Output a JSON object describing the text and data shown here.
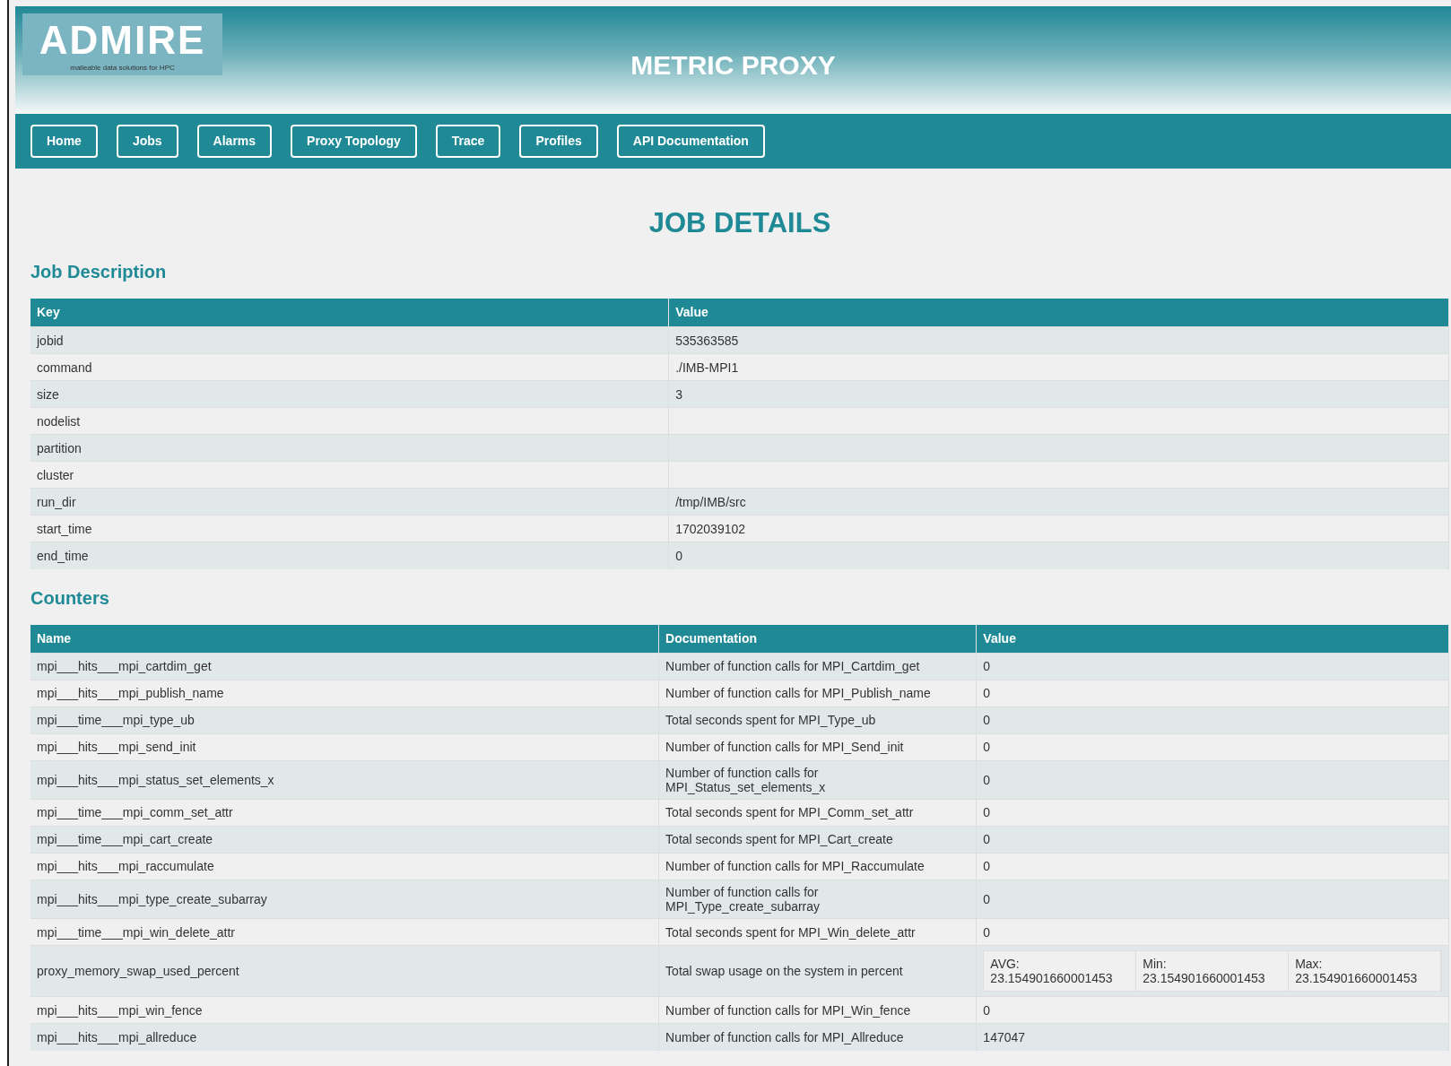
{
  "logo": {
    "wordmark": "ADMIRE",
    "tagline": "malleable data solutions for HPC"
  },
  "header": {
    "title": "METRIC PROXY"
  },
  "nav": [
    {
      "label": "Home"
    },
    {
      "label": "Jobs"
    },
    {
      "label": "Alarms"
    },
    {
      "label": "Proxy Topology"
    },
    {
      "label": "Trace"
    },
    {
      "label": "Profiles"
    },
    {
      "label": "API Documentation"
    }
  ],
  "page_title": "JOB DETAILS",
  "job_description": {
    "heading": "Job Description",
    "columns": [
      "Key",
      "Value"
    ],
    "rows": [
      {
        "key": "jobid",
        "value": "535363585"
      },
      {
        "key": "command",
        "value": "./IMB-MPI1"
      },
      {
        "key": "size",
        "value": "3"
      },
      {
        "key": "nodelist"
      },
      {
        "key": "partition"
      },
      {
        "key": "cluster"
      },
      {
        "key": "run_dir",
        "value": "/tmp/IMB/src"
      },
      {
        "key": "start_time",
        "value": "1702039102"
      },
      {
        "key": "end_time",
        "value": "0"
      }
    ]
  },
  "counters": {
    "heading": "Counters",
    "columns": [
      "Name",
      "Documentation",
      "Value"
    ],
    "rows": [
      {
        "kind": "single",
        "name": "mpi___hits___mpi_cartdim_get",
        "documentation": "Number of function calls for MPI_Cartdim_get",
        "value": "0"
      },
      {
        "kind": "single",
        "name": "mpi___hits___mpi_publish_name",
        "documentation": "Number of function calls for MPI_Publish_name",
        "value": "0"
      },
      {
        "kind": "single",
        "name": "mpi___time___mpi_type_ub",
        "documentation": "Total seconds spent for MPI_Type_ub",
        "value": "0"
      },
      {
        "kind": "single",
        "name": "mpi___hits___mpi_send_init",
        "documentation": "Number of function calls for MPI_Send_init",
        "value": "0"
      },
      {
        "kind": "single",
        "name": "mpi___hits___mpi_status_set_elements_x",
        "documentation": "Number of function calls for MPI_Status_set_elements_x",
        "value": "0"
      },
      {
        "kind": "single",
        "name": "mpi___time___mpi_comm_set_attr",
        "documentation": "Total seconds spent for MPI_Comm_set_attr",
        "value": "0"
      },
      {
        "kind": "single",
        "name": "mpi___time___mpi_cart_create",
        "documentation": "Total seconds spent for MPI_Cart_create",
        "value": "0"
      },
      {
        "kind": "single",
        "name": "mpi___hits___mpi_raccumulate",
        "documentation": "Number of function calls for MPI_Raccumulate",
        "value": "0"
      },
      {
        "kind": "single",
        "name": "mpi___hits___mpi_type_create_subarray",
        "documentation": "Number of function calls for MPI_Type_create_subarray",
        "value": "0"
      },
      {
        "kind": "single",
        "name": "mpi___time___mpi_win_delete_attr",
        "documentation": "Total seconds spent for MPI_Win_delete_attr",
        "value": "0"
      },
      {
        "kind": "stats",
        "name": "proxy_memory_swap_used_percent",
        "documentation": "Total swap usage on the system in percent",
        "stats": [
          {
            "label": "AVG:",
            "value": "23.154901660001453"
          },
          {
            "label": "Min:",
            "value": "23.154901660001453"
          },
          {
            "label": "Max:",
            "value": "23.154901660001453"
          }
        ]
      },
      {
        "kind": "single",
        "name": "mpi___hits___mpi_win_fence",
        "documentation": "Number of function calls for MPI_Win_fence",
        "value": "0"
      },
      {
        "kind": "single",
        "name": "mpi___hits___mpi_allreduce",
        "documentation": "Number of function calls for MPI_Allreduce",
        "value": "147047"
      }
    ]
  }
}
